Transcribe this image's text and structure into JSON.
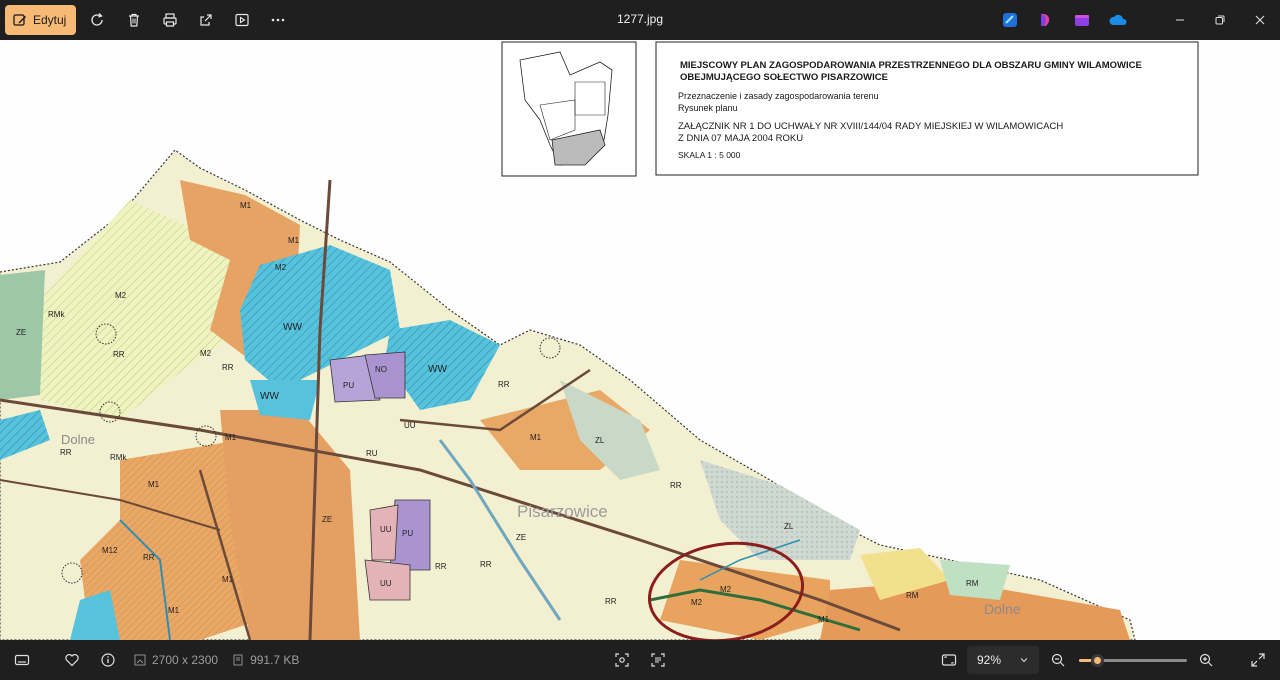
{
  "toolbar": {
    "edit_label": "Edytuj",
    "title": "1277.jpg",
    "icons": [
      "rotate-icon",
      "delete-icon",
      "print-icon",
      "share-icon",
      "slideshow-icon",
      "more-icon"
    ],
    "apps": [
      "clipchamp-icon",
      "designer-icon",
      "video-editor-icon",
      "onedrive-icon"
    ]
  },
  "map": {
    "heading_line1": "MIEJSCOWY PLAN ZAGOSPODAROWANIA PRZESTRZENNEGO DLA OBSZARU GMINY WILAMOWICE",
    "heading_line2": "OBEJMUJĄCEGO SOŁECTWO PISARZOWICE",
    "line3": "Przeznaczenie i zasady zagospodarowania terenu",
    "line4": "Rysunek planu",
    "line5": "ZAŁĄCZNIK NR 1 DO UCHWAŁY NR XVIII/144/04 RADY MIEJSKIEJ W WILAMOWICACH",
    "line6": "Z DNIA 07 MAJA 2004 ROKU",
    "line7": "SKALA 1 : 5 000",
    "place_name": "Pisarzowice",
    "labels": [
      "M1",
      "M2",
      "RR",
      "WW",
      "PU",
      "NO",
      "ZE",
      "ZL",
      "UU",
      "RU",
      "RM",
      "RMk",
      "M12",
      "Dolne"
    ],
    "colors": {
      "residential": "#e8a565",
      "agri": "#eef3b8",
      "water": "#55c3dd",
      "forest": "#c9dbcc",
      "service": "#b6a3d8",
      "highlight": "#8b1d1d"
    }
  },
  "status": {
    "dimensions": "2700 x 2300",
    "filesize": "991.7 KB",
    "zoom": "92%",
    "zoom_fraction": 0.17
  }
}
